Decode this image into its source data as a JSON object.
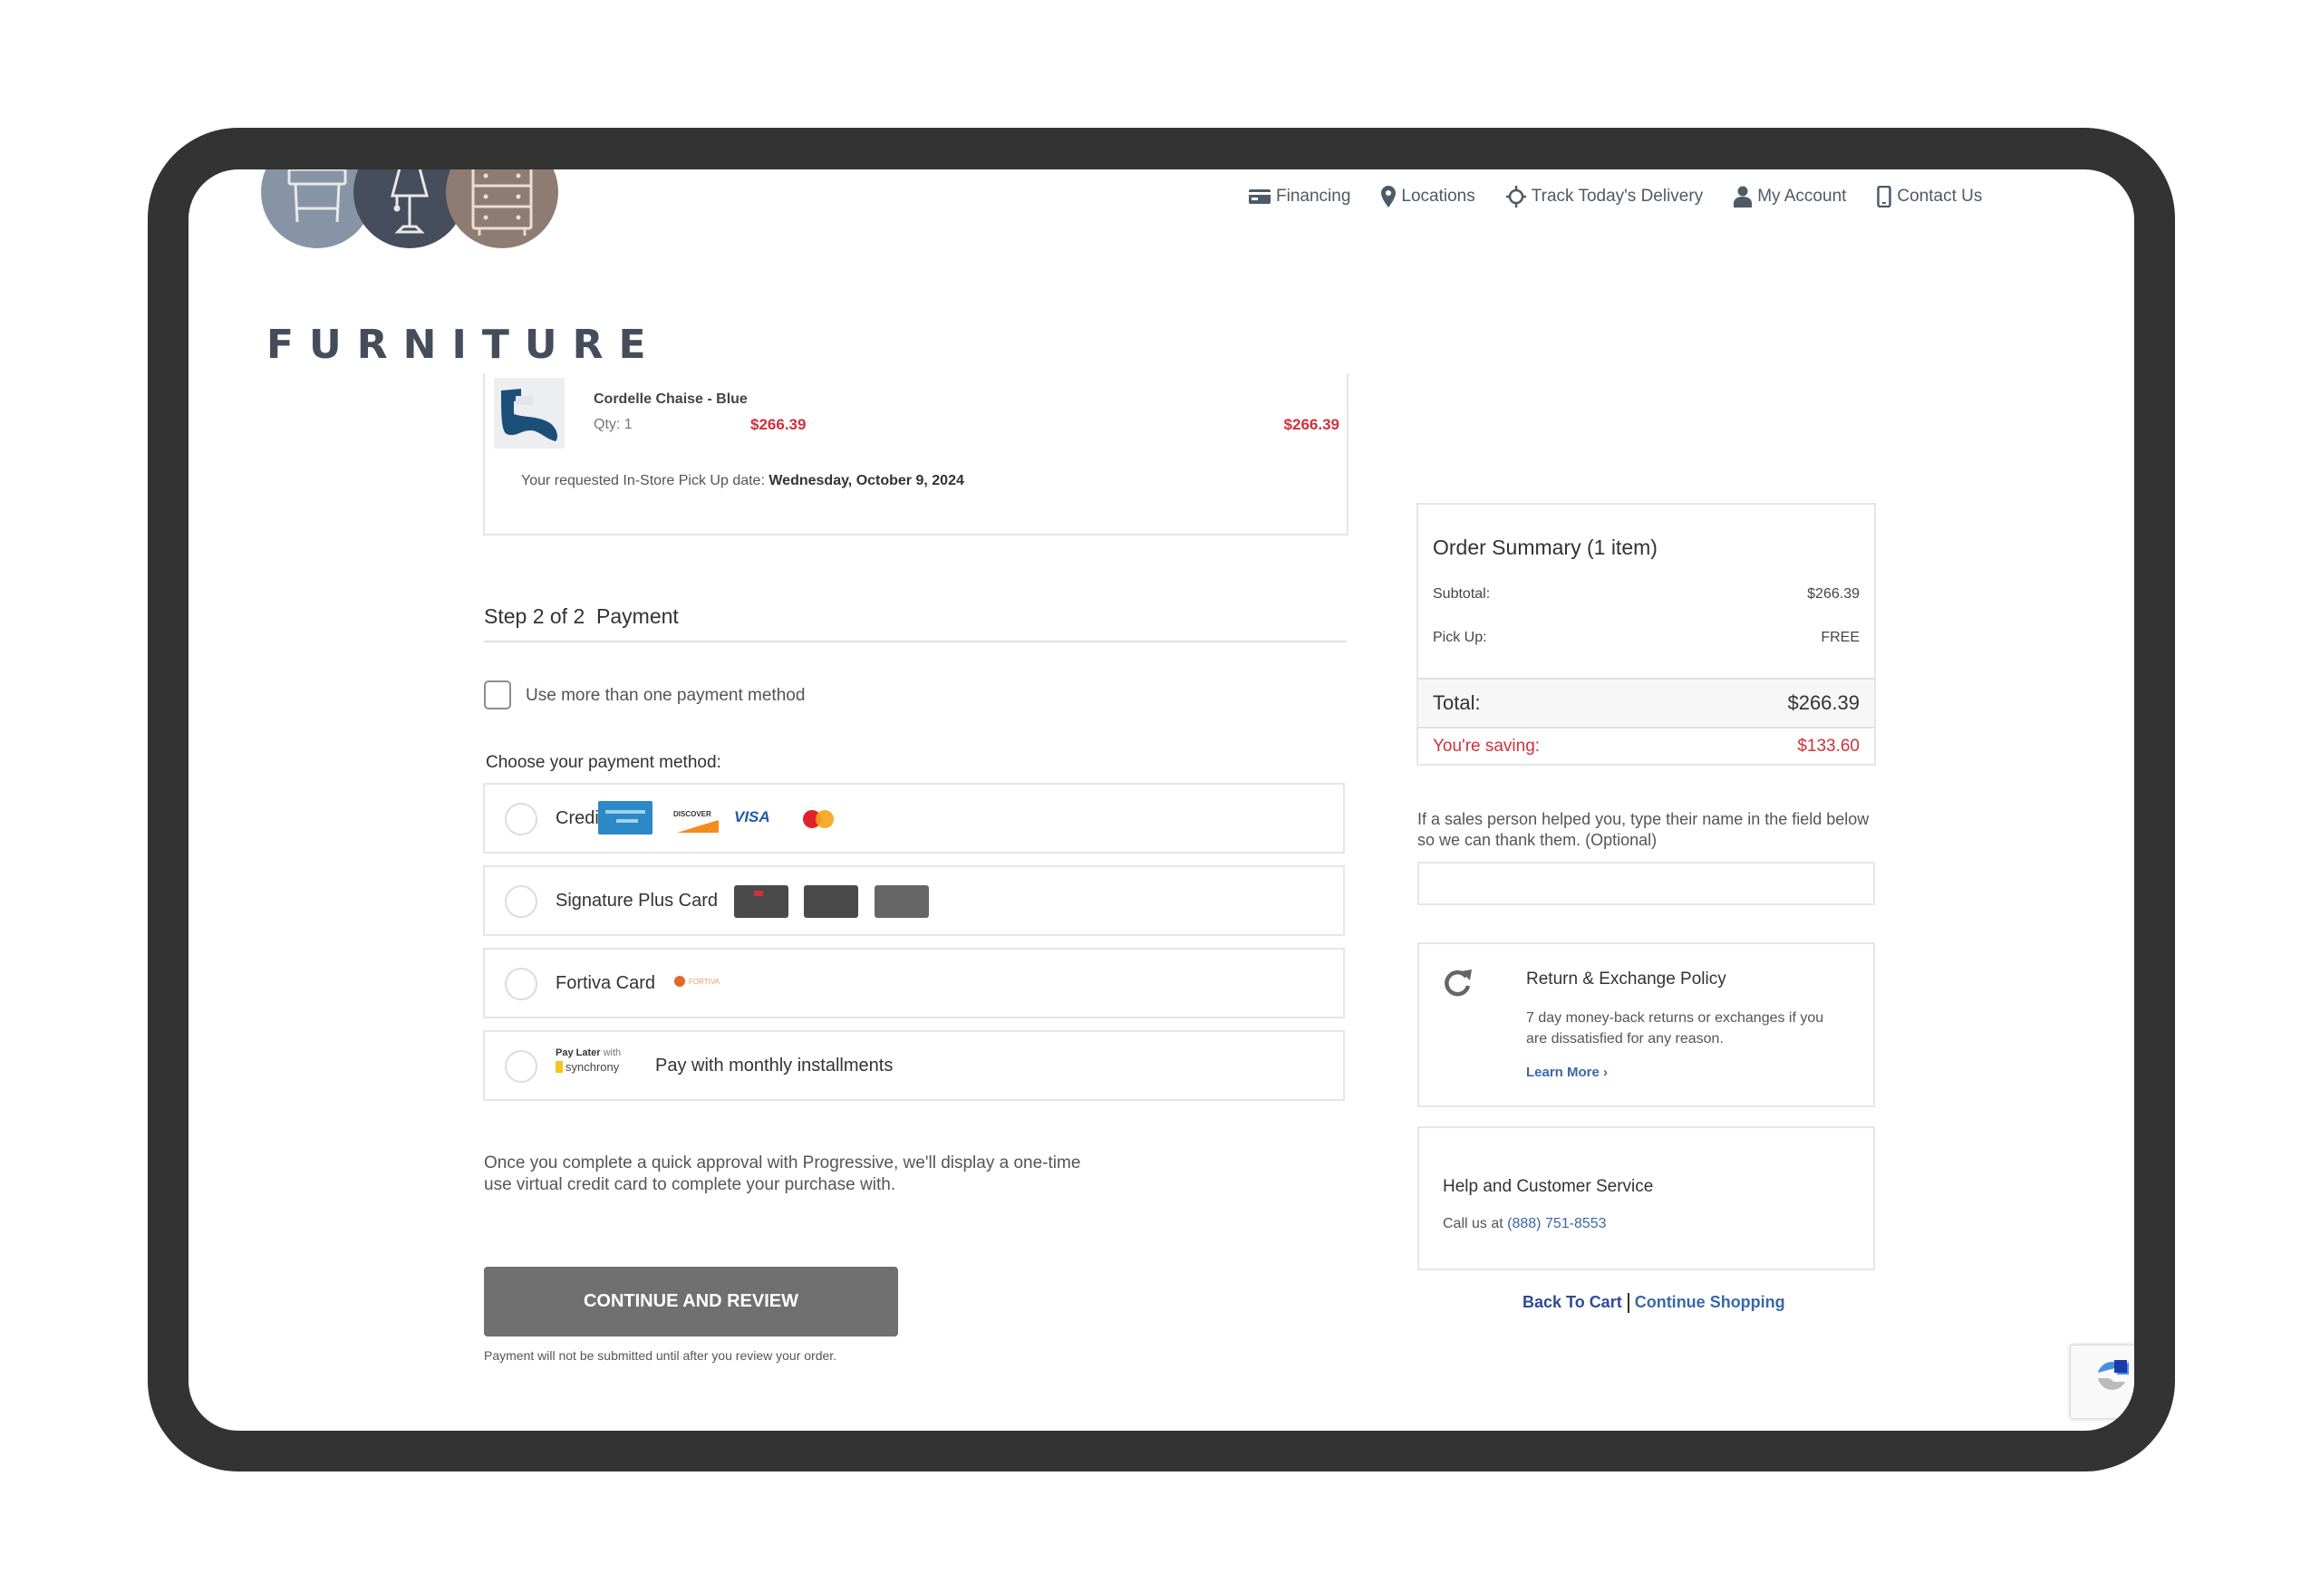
{
  "brand": {
    "logo_word": "FURNITURE",
    "logo_icons": [
      "table-icon",
      "lamp-icon",
      "dresser-icon"
    ],
    "colors": {
      "circle_1": "#8794a5",
      "circle_2": "#464e5d",
      "circle_3": "#8e7c73"
    }
  },
  "nav": [
    {
      "label": "Financing",
      "icon": "credit-card-icon"
    },
    {
      "label": "Locations",
      "icon": "map-pin-icon"
    },
    {
      "label": "Track Today's Delivery",
      "icon": "crosshair-icon"
    },
    {
      "label": "My Account",
      "icon": "user-icon"
    },
    {
      "label": "Contact Us",
      "icon": "phone-icon"
    }
  ],
  "cart_item": {
    "name": "Cordelle Chaise - Blue",
    "qty": "Qty: 1",
    "unit_price": "$266.39",
    "line_total": "$266.39",
    "pickup_label": "Your requested In-Store Pick Up date:",
    "pickup_date": "Wednesday, October 9, 2024"
  },
  "payment": {
    "step_heading": "Step 2 of 2  Payment",
    "multi_method_label": "Use more than one payment method",
    "multi_method_checked": false,
    "choose_label": "Choose your payment method:",
    "methods": [
      {
        "label": "Credit/Debit",
        "badges": [
          "AMERICAN EXPRESS",
          "DISCOVER",
          "VISA",
          "MasterCard"
        ]
      },
      {
        "label": "Signature Plus Card",
        "badges": [
          "signature-card-1",
          "signature-card-2",
          "Designer Looks"
        ]
      },
      {
        "label": "Fortiva Card",
        "badges": [
          "FORTIVA"
        ]
      },
      {
        "label": "Pay with monthly installments",
        "brand_top": "Pay Later",
        "brand_with": "with",
        "brand_name": "synchrony"
      }
    ],
    "progressive_note": "Once you complete a quick approval with Progressive, we'll display a one-time use virtual credit card to complete your purchase with.",
    "continue_label": "CONTINUE AND REVIEW",
    "footnote": "Payment will not be submitted until after you review your order."
  },
  "summary": {
    "title": "Order Summary (1 item)",
    "subtotal_label": "Subtotal:",
    "subtotal": "$266.39",
    "pickup_label": "Pick Up:",
    "pickup": "FREE",
    "total_label": "Total:",
    "total": "$266.39",
    "saving_label": "You're saving:",
    "saving": "$133.60"
  },
  "salesperson": {
    "prompt": "If a sales person helped you, type their name in the field below so we can thank them. (Optional)",
    "value": "",
    "placeholder": ""
  },
  "return_policy": {
    "title": "Return & Exchange Policy",
    "text": "7 day money-back returns or exchanges if you are dissatisfied for any reason.",
    "link": "Learn More ›"
  },
  "help": {
    "title": "Help and Customer Service",
    "call_label": "Call us at",
    "phone": "(888) 751-8553"
  },
  "links": {
    "back_to_cart": "Back To Cart",
    "continue_shopping": "Continue Shopping"
  },
  "accent_colors": {
    "price_red": "#d0303c",
    "link_blue": "#3a68a8",
    "button_gray": "#707070"
  }
}
